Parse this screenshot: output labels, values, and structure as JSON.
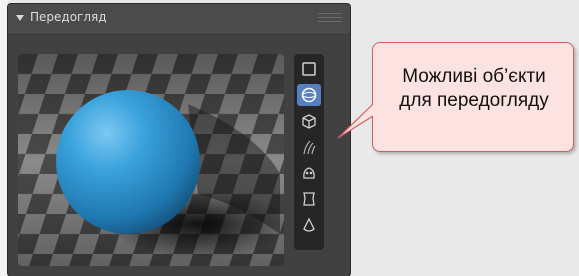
{
  "panel": {
    "title": "Передогляд"
  },
  "preview": {
    "object": "sphere",
    "sphere_color": "#2f95d3",
    "floor": "checkerboard"
  },
  "toolbar": {
    "buttons": [
      {
        "icon": "flat-square-icon",
        "active": false
      },
      {
        "icon": "sphere-icon",
        "active": true
      },
      {
        "icon": "cube-icon",
        "active": false
      },
      {
        "icon": "hair-icon",
        "active": false
      },
      {
        "icon": "monkey-icon",
        "active": false
      },
      {
        "icon": "cloth-icon",
        "active": false
      },
      {
        "icon": "fluid-drop-icon",
        "active": false
      }
    ],
    "active_color": "#5680c2"
  },
  "callout": {
    "text_line1": "Можливі об’єкти",
    "text_line2": "для передогляду",
    "background": "#fde2e2",
    "border": "#d06060"
  }
}
